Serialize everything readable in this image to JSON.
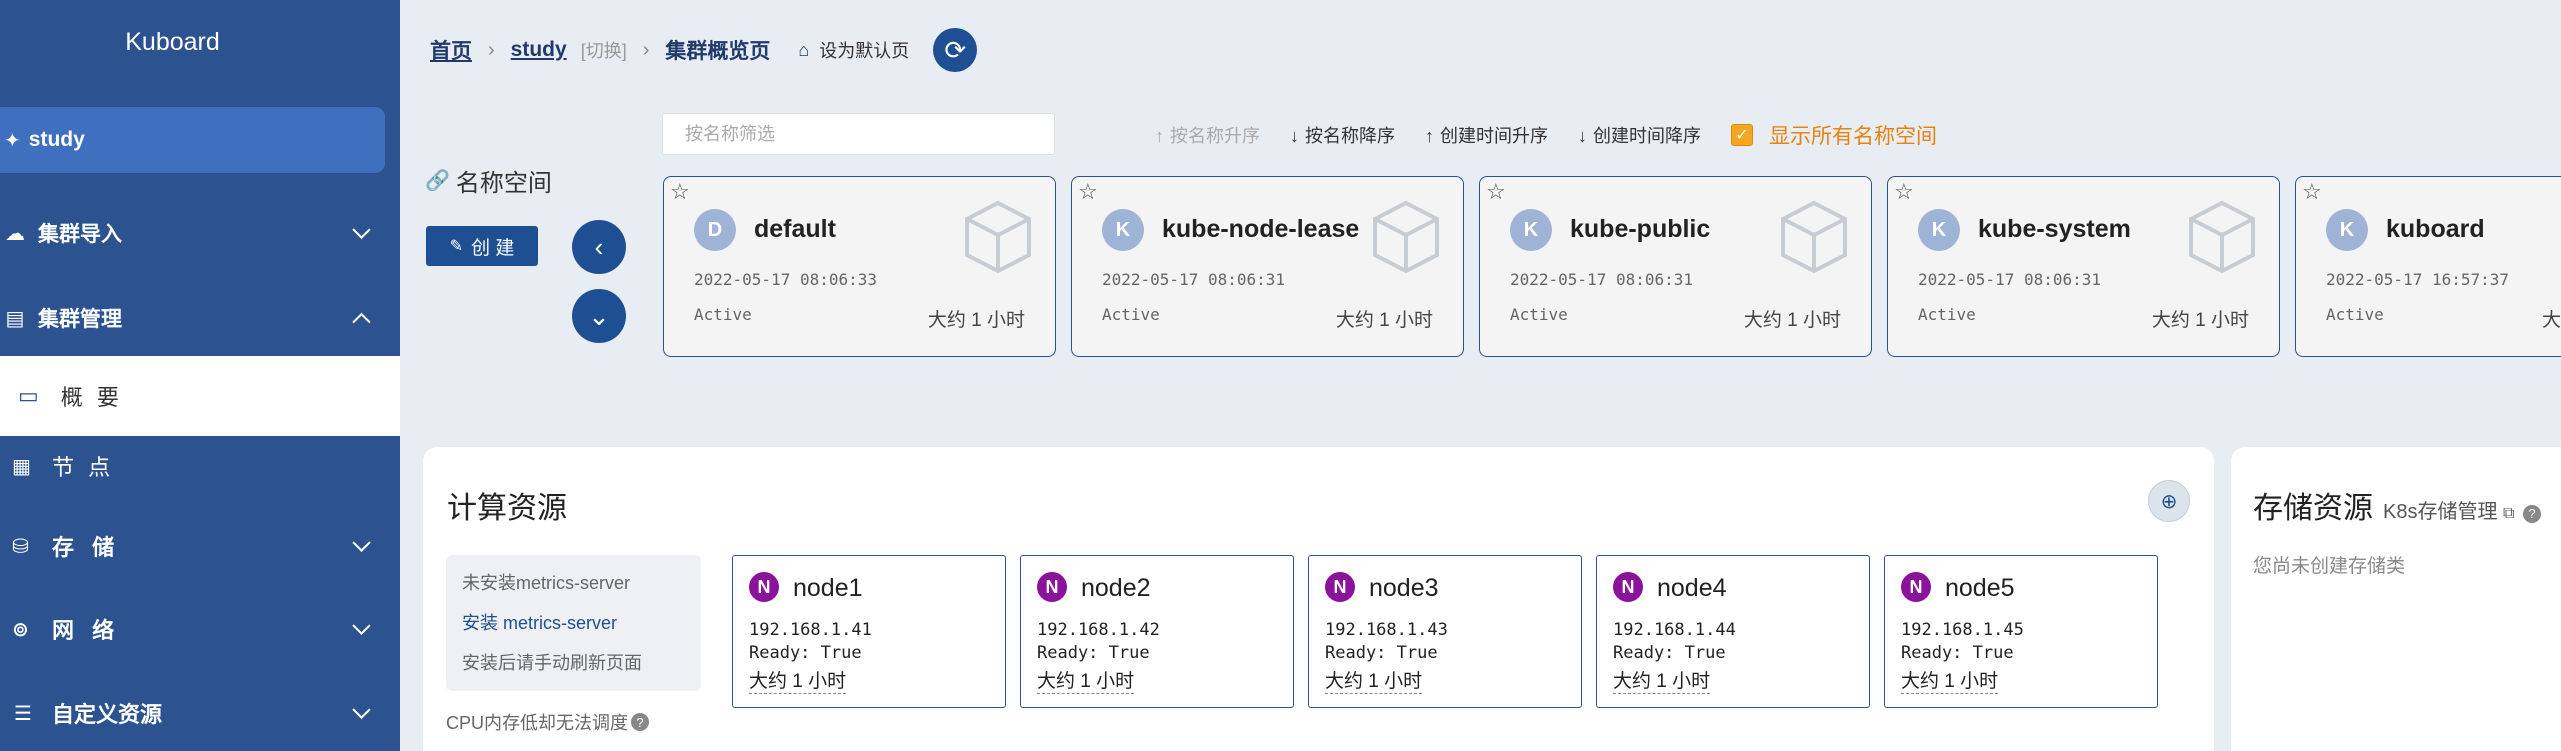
{
  "sidebar": {
    "brand": "Kuboard",
    "cluster": "study",
    "items": [
      {
        "label": "集群导入",
        "icon": "cloud-icon"
      },
      {
        "label": "集群管理",
        "icon": "server-icon"
      }
    ],
    "active_item": "概 要",
    "sub_items": [
      {
        "label": "节 点",
        "icon": "grid-icon"
      },
      {
        "label": "存 储",
        "icon": "database-icon"
      },
      {
        "label": "网 络",
        "icon": "network-icon"
      },
      {
        "label": "自定义资源",
        "icon": "sliders-icon"
      }
    ]
  },
  "breadcrumb": {
    "home": "首页",
    "cluster": "study",
    "switch": "[切换]",
    "current": "集群概览页",
    "set_default": "设为默认页"
  },
  "namespace": {
    "label": "名称空间",
    "create_button": "创 建",
    "filter_placeholder": "按名称筛选",
    "sort_options": [
      "按名称升序",
      "按名称降序",
      "创建时间升序",
      "创建时间降序"
    ],
    "show_all_label": "显示所有名称空间",
    "cards": [
      {
        "initial": "D",
        "name": "default",
        "created": "2022-05-17 08:06:33",
        "status": "Active",
        "age": "大约 1 小时"
      },
      {
        "initial": "K",
        "name": "kube-node-lease",
        "created": "2022-05-17 08:06:31",
        "status": "Active",
        "age": "大约 1 小时"
      },
      {
        "initial": "K",
        "name": "kube-public",
        "created": "2022-05-17 08:06:31",
        "status": "Active",
        "age": "大约 1 小时"
      },
      {
        "initial": "K",
        "name": "kube-system",
        "created": "2022-05-17 08:06:31",
        "status": "Active",
        "age": "大约 1 小时"
      },
      {
        "initial": "K",
        "name": "kuboard",
        "created": "2022-05-17 16:57:37",
        "status": "Active",
        "age": "大"
      }
    ]
  },
  "compute": {
    "title": "计算资源",
    "metrics_missing": "未安装metrics-server",
    "metrics_install": "安装 metrics-server",
    "metrics_refresh": "安装后请手动刷新页面",
    "cpu_note": "CPU内存低却无法调度",
    "nodes": [
      {
        "badge": "N",
        "name": "node1",
        "ip": "192.168.1.41",
        "ready": "Ready: True",
        "age": "大约 1 小时"
      },
      {
        "badge": "N",
        "name": "node2",
        "ip": "192.168.1.42",
        "ready": "Ready: True",
        "age": "大约 1 小时"
      },
      {
        "badge": "N",
        "name": "node3",
        "ip": "192.168.1.43",
        "ready": "Ready: True",
        "age": "大约 1 小时"
      },
      {
        "badge": "N",
        "name": "node4",
        "ip": "192.168.1.44",
        "ready": "Ready: True",
        "age": "大约 1 小时"
      },
      {
        "badge": "N",
        "name": "node5",
        "ip": "192.168.1.45",
        "ready": "Ready: True",
        "age": "大约 1 小时"
      }
    ]
  },
  "storage": {
    "title": "存储资源",
    "link": "K8s存储管理",
    "empty": "您尚未创建存储类"
  },
  "colors": {
    "sidebar": "#2c5390",
    "accent": "#1f4f93",
    "node_badge": "#8b139c",
    "warning": "#e6820e"
  }
}
